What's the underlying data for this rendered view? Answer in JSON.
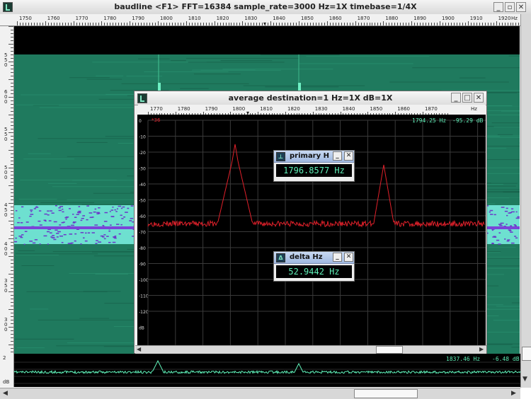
{
  "window": {
    "title": "baudline  <F1> FFT=16384 sample_rate=3000 Hz=1X timebase=1/4X"
  },
  "top_ruler": {
    "ticks": [
      "1750",
      "1760",
      "1770",
      "1780",
      "1790",
      "1800",
      "1810",
      "1820",
      "1830",
      "1840",
      "1850",
      "1860",
      "1870",
      "1880",
      "1890",
      "1900",
      "1910",
      "1920"
    ],
    "unit": "Hz"
  },
  "left_ruler": {
    "ticks": [
      "550",
      "600",
      "550",
      "500",
      "450",
      "400",
      "350",
      "300"
    ]
  },
  "average_window": {
    "title": "average  destination=1 Hz=1X dB=1X",
    "ruler_ticks": [
      "1770",
      "1780",
      "1790",
      "1800",
      "1810",
      "1820",
      "1830",
      "1840",
      "1850",
      "1860",
      "1870"
    ],
    "ruler_unit": "Hz",
    "y_ticks": [
      "0",
      "-10",
      "-20",
      "-30",
      "-40",
      "-50",
      "-60",
      "-70",
      "-80",
      "-90",
      "-100",
      "-110",
      "-120"
    ],
    "y_unit": "dB",
    "marker": "*36",
    "cursor_freq": "1794.25 Hz",
    "cursor_db": "-95.29 dB"
  },
  "primary_readout": {
    "label": "primary H",
    "value": "1796.8577 Hz",
    "icon": "⊥"
  },
  "delta_readout": {
    "label": "delta Hz",
    "value": "52.9442 Hz",
    "icon": "Δ"
  },
  "bottom_strip": {
    "cursor_freq": "1837.46 Hz",
    "cursor_db": "-6.48 dB",
    "unit": "dB"
  },
  "colors": {
    "spectro_green": "#1f7a5e",
    "trace_red": "#e0202a",
    "trace_green": "#5ff0b8",
    "band_purple": "#6a38c8"
  }
}
